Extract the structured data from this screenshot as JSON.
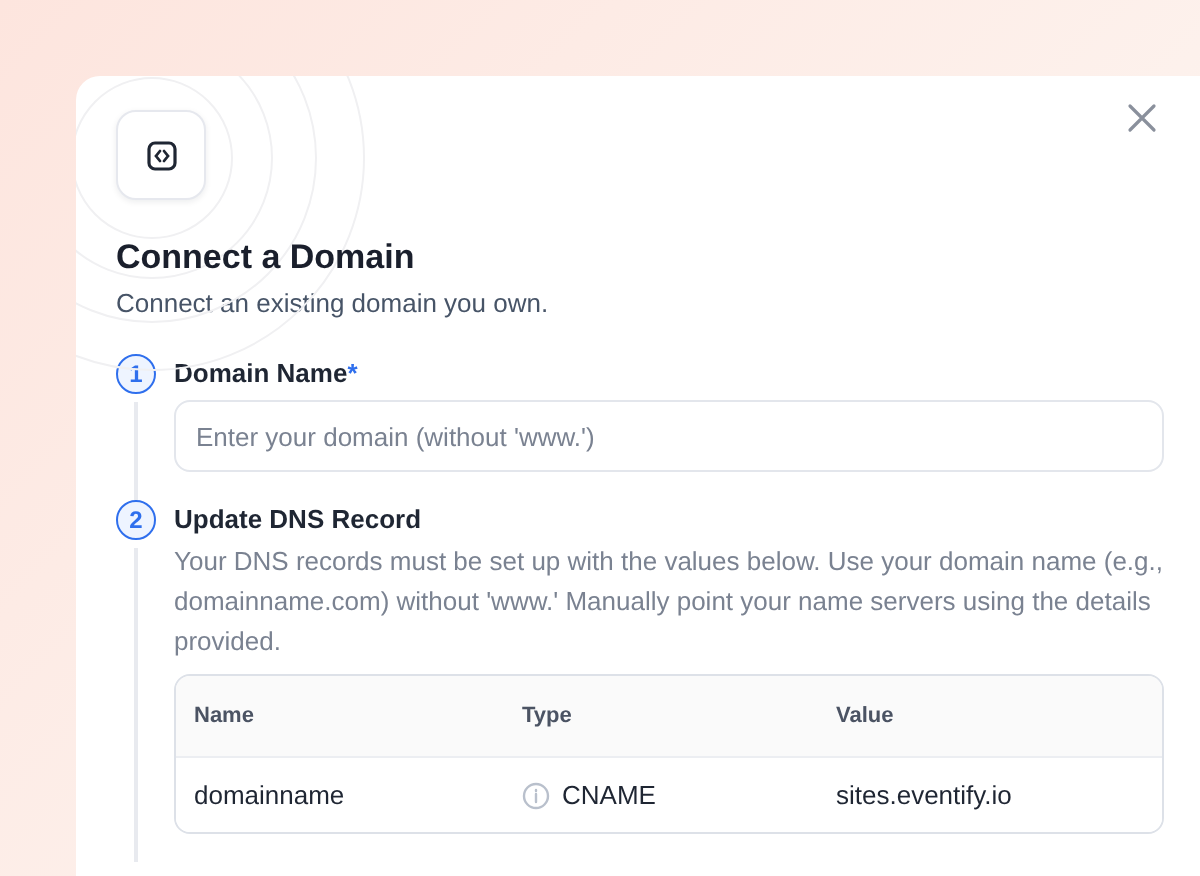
{
  "dialog": {
    "title": "Connect a Domain",
    "subtitle": "Connect an existing domain you own."
  },
  "steps": [
    {
      "number": "1",
      "title": "Domain Name",
      "required_mark": "*",
      "kind": "input",
      "placeholder": "Enter your domain (without 'www.')"
    },
    {
      "number": "2",
      "title": "Update DNS Record",
      "kind": "table",
      "description": "Your DNS records must be set up with the values below. Use your domain name (e.g., domainname.com) without 'www.' Manually point your name servers using the details provided.",
      "table": {
        "columns": [
          "Name",
          "Type",
          "Value"
        ],
        "rows": [
          [
            "domainname",
            "CNAME",
            "sites.eventify.io"
          ]
        ]
      }
    }
  ]
}
